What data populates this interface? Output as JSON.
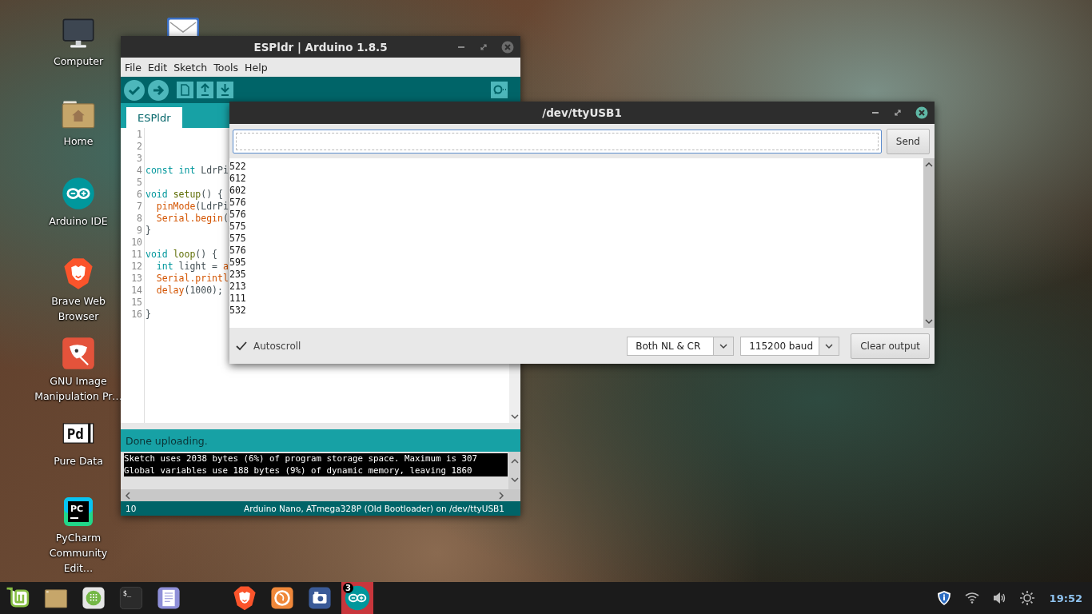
{
  "desktop_icons": [
    {
      "kind": "computer",
      "label": "Computer"
    },
    {
      "kind": "home",
      "label": "Home"
    },
    {
      "kind": "arduino",
      "label": "Arduino IDE"
    },
    {
      "kind": "brave",
      "label": "Brave Web Browser"
    },
    {
      "kind": "gimp",
      "label": "GNU Image Manipulation Pr…"
    },
    {
      "kind": "puredata",
      "label": "Pure Data",
      "logo_text": "Pd"
    },
    {
      "kind": "pycharm",
      "label": "PyCharm Community Edit…",
      "logo_text": "PC"
    }
  ],
  "ide_window": {
    "title": "ESPldr | Arduino 1.8.5",
    "menu": [
      "File",
      "Edit",
      "Sketch",
      "Tools",
      "Help"
    ],
    "tabs": [
      {
        "label": "ESPldr",
        "selected": true
      }
    ],
    "code_lines": [
      {
        "number": "1"
      },
      {
        "number": "2"
      },
      {
        "number": "3"
      },
      {
        "number": "4",
        "tokens": [
          {
            "kind": "keyword",
            "text": "const int"
          },
          {
            "kind": "plain",
            "text": " LdrPi"
          }
        ]
      },
      {
        "number": "5"
      },
      {
        "number": "6",
        "tokens": [
          {
            "kind": "keyword",
            "text": "void "
          },
          {
            "kind": "function",
            "text": "setup"
          },
          {
            "kind": "plain",
            "text": "() {"
          }
        ]
      },
      {
        "number": "7",
        "indented": true,
        "tokens": [
          {
            "kind": "builtin",
            "text": "pinMode"
          },
          {
            "kind": "plain",
            "text": "(LdrPi"
          }
        ]
      },
      {
        "number": "8",
        "indented": true,
        "tokens": [
          {
            "kind": "builtin",
            "text": "Serial"
          },
          {
            "kind": "builtin",
            "text": ".begin"
          },
          {
            "kind": "plain",
            "text": "("
          }
        ]
      },
      {
        "number": "9",
        "tokens": [
          {
            "kind": "plain",
            "text": "}"
          }
        ]
      },
      {
        "number": "10"
      },
      {
        "number": "11",
        "tokens": [
          {
            "kind": "keyword",
            "text": "void "
          },
          {
            "kind": "function",
            "text": "loop"
          },
          {
            "kind": "plain",
            "text": "() {"
          }
        ]
      },
      {
        "number": "12",
        "indented": true,
        "tokens": [
          {
            "kind": "keyword",
            "text": "int"
          },
          {
            "kind": "plain",
            "text": " light = "
          },
          {
            "kind": "builtin",
            "text": "a"
          }
        ]
      },
      {
        "number": "13",
        "indented": true,
        "tokens": [
          {
            "kind": "builtin",
            "text": "Serial"
          },
          {
            "kind": "builtin",
            "text": ".printl"
          }
        ]
      },
      {
        "number": "14",
        "indented": true,
        "tokens": [
          {
            "kind": "builtin",
            "text": "delay"
          },
          {
            "kind": "plain",
            "text": "(1000);"
          }
        ]
      },
      {
        "number": "15"
      },
      {
        "number": "16",
        "tokens": [
          {
            "kind": "plain",
            "text": "}"
          }
        ]
      }
    ],
    "status_message": "Done uploading.",
    "console_lines": [
      "Sketch uses 2038 bytes (6%) of program storage space. Maximum is 307",
      "Global variables use 188 bytes (9%) of dynamic memory, leaving 1860"
    ],
    "footer": {
      "line": "10",
      "board": "Arduino Nano, ATmega328P (Old Bootloader) on /dev/ttyUSB1"
    }
  },
  "serial_monitor": {
    "title": "/dev/ttyUSB1",
    "send_button": "Send",
    "output": [
      "522",
      "612",
      "602",
      "576",
      "576",
      "575",
      "575",
      "576",
      "595",
      "235",
      "213",
      "111",
      "532"
    ],
    "autoscroll": {
      "label": "Autoscroll",
      "checked": true
    },
    "line_ending": "Both NL & CR",
    "baud_rate": "115200 baud",
    "clear_button": "Clear output"
  },
  "taskbar": {
    "pinned": [
      {
        "kind": "mint",
        "active": false
      },
      {
        "kind": "folder",
        "active": false
      },
      {
        "kind": "apps",
        "active": false
      },
      {
        "kind": "terminal",
        "active": false,
        "logo_text": "$_"
      },
      {
        "kind": "editor",
        "active": false
      }
    ],
    "running": [
      {
        "kind": "brave",
        "active": false
      },
      {
        "kind": "firefox",
        "active": false
      },
      {
        "kind": "camera",
        "active": false
      },
      {
        "kind": "arduino",
        "active": true,
        "badge": "3"
      }
    ],
    "clock": "19:52"
  }
}
